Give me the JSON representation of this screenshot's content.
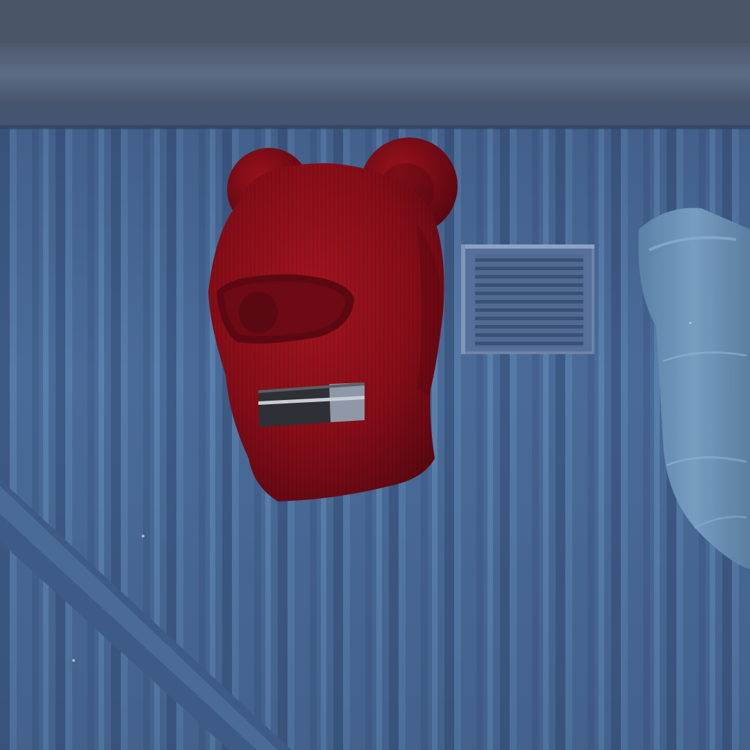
{
  "scene": {
    "item": "balaclava-with-bear-ears",
    "colors": {
      "mask_red": "#8e0f1a",
      "mask_shadow": "#5e0811",
      "mask_highlight": "#b01a24",
      "wall_blue": "#4a6b99",
      "wall_dark": "#38537c",
      "beam_gray": "#56647d",
      "vent_gray": "#6d83a8",
      "pipe_blue": "#6c8fb4",
      "tag_dark": "#2e3035",
      "tag_light": "#8e98a6"
    },
    "icons": [
      "balaclava-icon",
      "bear-ear-icon",
      "wall-vent-icon",
      "pipe-icon"
    ]
  }
}
